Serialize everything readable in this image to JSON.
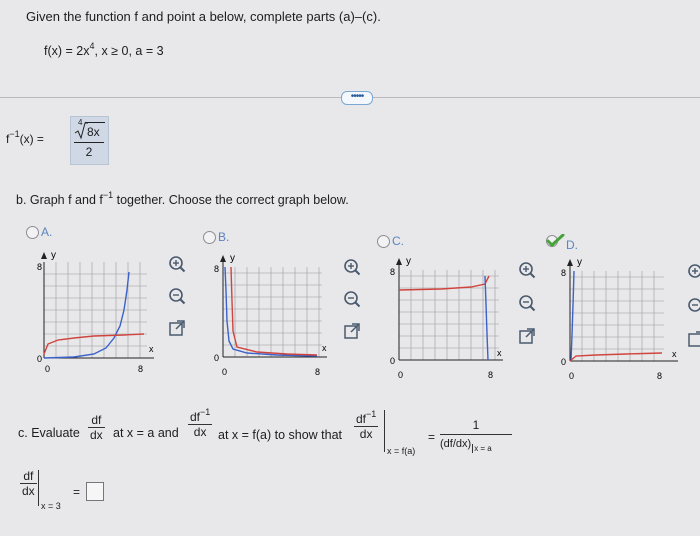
{
  "header": {
    "prompt": "Given the function f and point a below, complete parts (a)–(c).",
    "function_def": "f(x) = 2x",
    "function_exp": "4",
    "function_cond": ", x ≥ 0, a = 3"
  },
  "more_button": "•••••",
  "part_a": {
    "lhs_base": "f",
    "lhs_exp": "−1",
    "lhs_tail": "(x) =",
    "root_index": "4",
    "radicand": "8x",
    "denominator": "2"
  },
  "part_b": {
    "prefix": "b. Graph f and f",
    "exp": "−1",
    "suffix": " together. Choose the correct graph below.",
    "options": [
      {
        "letter": "A.",
        "selected": false
      },
      {
        "letter": "B.",
        "selected": false
      },
      {
        "letter": "C.",
        "selected": false
      },
      {
        "letter": "D.",
        "selected": true
      }
    ],
    "axis": {
      "y_label": "y",
      "x_label": "x",
      "y_tick": "8",
      "x_tick": "8",
      "origin_y": "0",
      "origin_x": "0"
    }
  },
  "part_c": {
    "prefix": "c. Evaluate",
    "df": "df",
    "dx": "dx",
    "at_a": "at x = a and",
    "dfinv": "df",
    "dfinv_exp": "−1",
    "at_fa": "at x = f(a) to show that",
    "eval_sub": "x = f(a)",
    "equals": "=",
    "one": "1",
    "rhs_den": "(df/dx)",
    "rhs_sub": "x = a"
  },
  "bottom": {
    "df": "df",
    "dx": "dx",
    "sub": "x = 3",
    "equals": "="
  },
  "colors": {
    "blue_curve": "#3b62c9",
    "red_curve": "#d0443e",
    "accent": "#5c84c0",
    "check": "#45a33a"
  },
  "icons": [
    "zoom-in-icon",
    "zoom-out-icon",
    "open-window-icon"
  ]
}
